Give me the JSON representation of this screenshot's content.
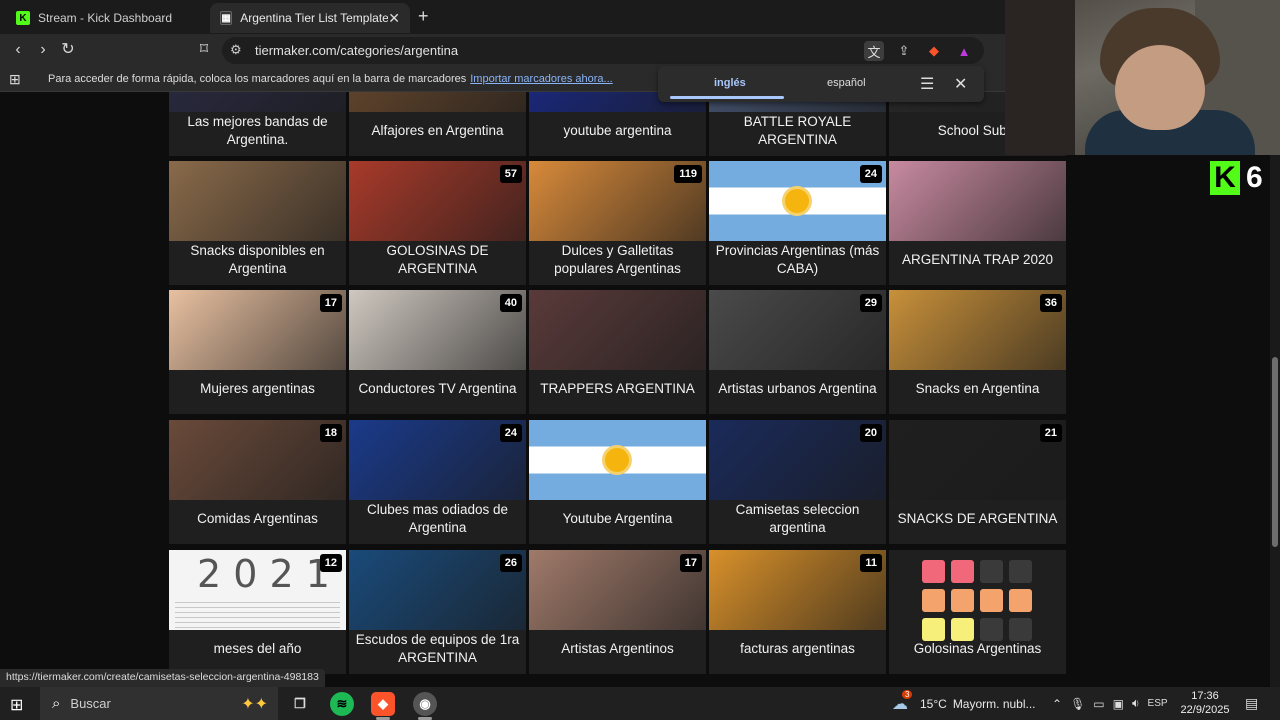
{
  "browser": {
    "tabs": [
      {
        "title": "Stream - Kick Dashboard",
        "favicon": "kick-icon",
        "color": "#53fc18"
      },
      {
        "title": "Argentina Tier List Templates - T",
        "favicon": "tiermaker-icon",
        "color": "#1a1a1a"
      }
    ],
    "url": "tiermaker.com/categories/argentina",
    "bookmarks_message": "Para acceder de forma rápida, coloca los marcadores aquí en la barra de marcadores",
    "bookmarks_link": "Importar marcadores ahora...",
    "translate": {
      "active": "inglés",
      "other": "español"
    },
    "status_url": "https://tiermaker.com/create/camisetas-seleccion-argentina-498183"
  },
  "cards": [
    {
      "title": "Las mejores bandas de Argentina.",
      "count": "",
      "color": "#2b2b44"
    },
    {
      "title": "Alfajores en Argentina",
      "count": "",
      "color": "#6b4a2e"
    },
    {
      "title": "youtube argentina",
      "count": "",
      "color": "#1a2a8a"
    },
    {
      "title": "BATTLE ROYALE ARGENTINA",
      "count": "",
      "color": "#4a5a7a"
    },
    {
      "title": "School Subje",
      "count": "",
      "color": "#2a2a2a"
    },
    {
      "title": "Snacks disponibles en Argentina",
      "count": "",
      "color": "#8a6a4a"
    },
    {
      "title": "GOLOSINAS DE ARGENTINA",
      "count": "57",
      "color": "#a83a2a"
    },
    {
      "title": "Dulces y Galletitas populares Argentinas",
      "count": "119",
      "color": "#d88a3a"
    },
    {
      "title": "Provincias Argentinas (más CABA)",
      "count": "24",
      "color": "flag"
    },
    {
      "title": "ARGENTINA TRAP 2020",
      "count": "",
      "color": "#c88aa0"
    },
    {
      "title": "Mujeres argentinas",
      "count": "17",
      "color": "#e8c0a0"
    },
    {
      "title": "Conductores TV Argentina",
      "count": "40",
      "color": "#cfc8c0"
    },
    {
      "title": "TRAPPERS ARGENTINA",
      "count": "",
      "color": "#5a3a3a"
    },
    {
      "title": "Artistas urbanos Argentina",
      "count": "29",
      "color": "#4a4a4a"
    },
    {
      "title": "Snacks en Argentina",
      "count": "36",
      "color": "#c8903a"
    },
    {
      "title": "Comidas Argentinas",
      "count": "18",
      "color": "#6a4a3a"
    },
    {
      "title": "Clubes mas odiados de Argentina",
      "count": "24",
      "color": "#1a3a8a"
    },
    {
      "title": "Youtube Argentina",
      "count": "",
      "color": "flag"
    },
    {
      "title": "Camisetas seleccion argentina",
      "count": "20",
      "color": "#1a2a5a"
    },
    {
      "title": "SNACKS DE ARGENTINA",
      "count": "21",
      "color": "#1f1f1f"
    },
    {
      "title": "meses del año",
      "count": "12",
      "color": "calendar"
    },
    {
      "title": "Escudos de equipos de 1ra ARGENTINA",
      "count": "26",
      "color": "#1a4a7a"
    },
    {
      "title": "Artistas Argentinos",
      "count": "17",
      "color": "#a07a6a"
    },
    {
      "title": "facturas argentinas",
      "count": "11",
      "color": "#d8902a"
    },
    {
      "title": "Golosinas Argentinas",
      "count": "",
      "color": "tiles"
    }
  ],
  "calendar_text": "2 0 2 1",
  "overlay": {
    "kick_label": "K",
    "viewer_count": "6"
  },
  "taskbar": {
    "search_placeholder": "Buscar",
    "weather_temp": "15°C",
    "weather_desc": "Mayorm. nubl...",
    "weather_badge": "3",
    "lang": "ESP",
    "time": "17:36",
    "date": "22/9/2025"
  }
}
